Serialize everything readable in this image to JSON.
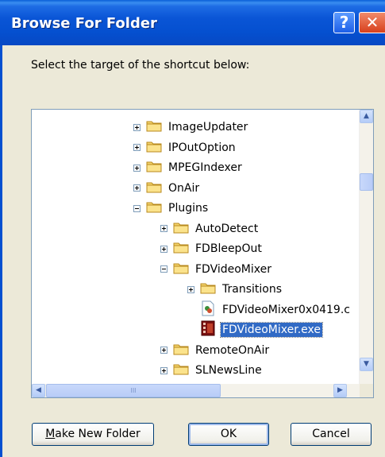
{
  "window": {
    "title": "Browse For Folder",
    "help_label": "?",
    "close_label": "✕"
  },
  "instruction": "Select the target of the shortcut below:",
  "tree": {
    "items": [
      {
        "label": "ImageUpdater",
        "type": "folder",
        "expander": "plus",
        "level": 1
      },
      {
        "label": "IPOutOption",
        "type": "folder",
        "expander": "plus",
        "level": 1
      },
      {
        "label": "MPEGIndexer",
        "type": "folder",
        "expander": "plus",
        "level": 1
      },
      {
        "label": "OnAir",
        "type": "folder",
        "expander": "plus",
        "level": 1
      },
      {
        "label": "Plugins",
        "type": "folder",
        "expander": "minus",
        "level": 1
      },
      {
        "label": "AutoDetect",
        "type": "folder",
        "expander": "plus",
        "level": 2
      },
      {
        "label": "FDBleepOut",
        "type": "folder",
        "expander": "plus",
        "level": 2
      },
      {
        "label": "FDVideoMixer",
        "type": "folder",
        "expander": "minus",
        "level": 2
      },
      {
        "label": "Transitions",
        "type": "folder",
        "expander": "plus",
        "level": 3
      },
      {
        "label": "FDVideoMixer0x0419.c",
        "type": "dll",
        "expander": "none",
        "level": 3
      },
      {
        "label": "FDVideoMixer.exe",
        "type": "exe",
        "expander": "none",
        "level": 3,
        "selected": true
      },
      {
        "label": "RemoteOnAir",
        "type": "folder",
        "expander": "plus",
        "level": 2
      },
      {
        "label": "SLNewsLine",
        "type": "folder",
        "expander": "plus",
        "level": 2
      }
    ]
  },
  "buttons": {
    "make_new_folder": "Make New Folder",
    "ok": "OK",
    "cancel": "Cancel"
  },
  "colors": {
    "titlebar": "#0550D0",
    "selection": "#316AC5",
    "dialog_bg": "#ECE9D8"
  }
}
